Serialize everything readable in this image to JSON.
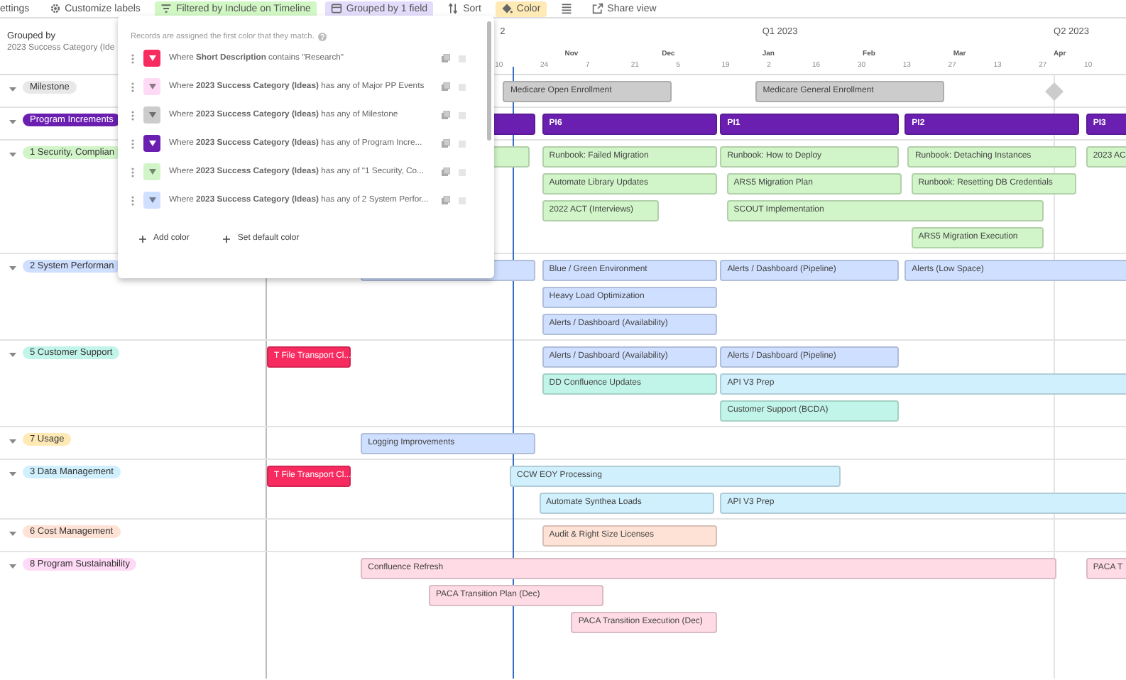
{
  "toolbar": [
    {
      "kind": "settings",
      "label": "ettings",
      "active": false
    },
    {
      "kind": "labels",
      "label": "Customize labels",
      "active": false
    },
    {
      "kind": "filter",
      "label": "Filtered by Include on Timeline",
      "active": true
    },
    {
      "kind": "group",
      "label": "Grouped by 1 field",
      "active": true
    },
    {
      "kind": "sort",
      "label": "Sort",
      "active": false
    },
    {
      "kind": "color",
      "label": "Color",
      "active": true
    },
    {
      "kind": "rowheight",
      "active": false
    },
    {
      "kind": "share",
      "label": "Share view",
      "active": false
    }
  ],
  "grouping": {
    "title": "Grouped by",
    "field": "2023 Success Category (Ide"
  },
  "axis": {
    "quarters": [
      "2",
      "Q1 2023",
      "Q2 2023"
    ],
    "months": [
      "Nov",
      "Dec",
      "Jan",
      "Feb",
      "Mar",
      "Apr"
    ],
    "weeks": [
      "10",
      "24",
      "7",
      "21",
      "5",
      "19",
      "2",
      "16",
      "30",
      "13",
      "27",
      "13",
      "27",
      "10"
    ]
  },
  "groups": [
    {
      "label": "Milestone",
      "color": "#e8e8e8",
      "expanded": true,
      "lanes": [
        [
          {
            "kind": "bar",
            "label": "Medicare Open Enrollment",
            "color": "#cccccc"
          },
          {
            "kind": "bar",
            "label": "Medicare General Enrollment",
            "color": "#cccccc"
          },
          {
            "kind": "milestone",
            "color": "#cccccc"
          }
        ]
      ]
    },
    {
      "label": "Program Increments",
      "color": "#6b1fb1",
      "expanded": true,
      "lanes": [
        [
          {
            "kind": "bar",
            "color": "#6b1fb1"
          },
          {
            "kind": "bar",
            "label": "PI6",
            "color": "#6b1fb1"
          },
          {
            "kind": "bar",
            "label": "PI1",
            "color": "#6b1fb1"
          },
          {
            "kind": "bar",
            "label": "PI2",
            "color": "#6b1fb1"
          },
          {
            "kind": "bar",
            "label": "PI3",
            "color": "#6b1fb1"
          }
        ]
      ]
    },
    {
      "label": "1 Security, Complian",
      "color": "#d1f5c8",
      "expanded": true,
      "lanes": [
        [
          {
            "kind": "bar",
            "color": "#d1f5c8"
          },
          {
            "kind": "bar",
            "label": "Runbook: Failed Migration",
            "color": "#d1f5c8"
          },
          {
            "kind": "bar",
            "label": "Runbook: How to Deploy",
            "color": "#d1f5c8"
          },
          {
            "kind": "bar",
            "label": "Runbook: Detaching Instances",
            "color": "#d1f5c8"
          },
          {
            "kind": "bar",
            "label": "2023 AC",
            "color": "#d1f5c8"
          }
        ],
        [
          {
            "kind": "bar",
            "label": "Automate Library Updates",
            "color": "#d1f5c8"
          },
          {
            "kind": "bar",
            "label": "ARS5 Migration Plan",
            "color": "#d1f5c8"
          },
          {
            "kind": "bar",
            "label": "Runbook: Resetting DB Credentials",
            "color": "#d1f5c8"
          }
        ],
        [
          {
            "kind": "bar",
            "label": "2022 ACT (Interviews)",
            "color": "#d1f5c8"
          },
          {
            "kind": "bar",
            "label": "SCOUT Implementation",
            "color": "#d1f5c8"
          }
        ],
        [
          {
            "kind": "bar",
            "label": "ARS5 Migration Execution",
            "color": "#d1f5c8"
          }
        ]
      ]
    },
    {
      "label": "2 System Performan",
      "color": "#cfdfff",
      "expanded": true,
      "lanes": [
        [
          {
            "kind": "bar",
            "color": "#cfdfff"
          },
          {
            "kind": "bar",
            "label": "Blue / Green Environment",
            "color": "#cfdfff"
          },
          {
            "kind": "bar",
            "label": "Alerts / Dashboard (Pipeline)",
            "color": "#cfdfff"
          },
          {
            "kind": "bar",
            "label": "Alerts (Low Space)",
            "color": "#cfdfff"
          }
        ],
        [
          {
            "kind": "bar",
            "label": "Heavy Load Optimization",
            "color": "#cfdfff"
          }
        ],
        [
          {
            "kind": "bar",
            "label": "Alerts / Dashboard (Availability)",
            "color": "#cfdfff"
          }
        ]
      ]
    },
    {
      "label": "5 Customer Support",
      "color": "#c2f5e9",
      "expanded": true,
      "lanes": [
        [
          {
            "kind": "bar",
            "label": "T File Transport Cl...",
            "color": "#f82b60"
          },
          {
            "kind": "bar",
            "label": "Alerts / Dashboard (Availability)",
            "color": "#cfdfff"
          },
          {
            "kind": "bar",
            "label": "Alerts / Dashboard (Pipeline)",
            "color": "#cfdfff"
          }
        ],
        [
          {
            "kind": "bar",
            "label": "DD Confluence Updates",
            "color": "#c2f5e9"
          },
          {
            "kind": "bar",
            "label": "API V3 Prep",
            "color": "#d0f0fd"
          }
        ],
        [
          {
            "kind": "bar",
            "label": "Customer Support (BCDA)",
            "color": "#c2f5e9"
          }
        ]
      ]
    },
    {
      "label": "7 Usage",
      "color": "#ffeab6",
      "expanded": true,
      "lanes": [
        [
          {
            "kind": "bar",
            "label": "Logging Improvements",
            "color": "#cfdfff"
          }
        ]
      ]
    },
    {
      "label": "3 Data Management",
      "color": "#d0f0fd",
      "expanded": true,
      "lanes": [
        [
          {
            "kind": "bar",
            "label": "T File Transport Cl...",
            "color": "#f82b60"
          },
          {
            "kind": "bar",
            "label": "CCW EOY Processing",
            "color": "#d0f0fd"
          }
        ],
        [
          {
            "kind": "bar",
            "label": "Automate Synthea Loads",
            "color": "#d0f0fd"
          },
          {
            "kind": "bar",
            "label": "API V3 Prep",
            "color": "#d0f0fd"
          }
        ]
      ]
    },
    {
      "label": "6 Cost Management",
      "color": "#fee2d5",
      "expanded": true,
      "lanes": [
        [
          {
            "kind": "bar",
            "label": "Audit & Right Size Licenses",
            "color": "#fee2d5"
          }
        ]
      ]
    },
    {
      "label": "8 Program Sustainability",
      "color": "#ffdaf6",
      "expanded": true,
      "lanes": [
        [
          {
            "kind": "bar",
            "label": "Confluence Refresh",
            "color": "#ffdce5"
          },
          {
            "kind": "bar",
            "label": "PACA T",
            "color": "#ffdce5"
          }
        ],
        [
          {
            "kind": "bar",
            "label": "PACA Transition Plan (Dec)",
            "color": "#ffdce5"
          }
        ],
        [
          {
            "kind": "bar",
            "label": "PACA Transition Execution (Dec)",
            "color": "#ffdce5"
          }
        ]
      ]
    }
  ],
  "color_popup": {
    "note": "Records are assigned the first color that they match.",
    "rules": [
      {
        "text": "Where **Short Description** contains \"Research\"",
        "color": "#f82b60"
      },
      {
        "text": "Where **2023 Success Category (Ideas)** has any of Major PP Events",
        "color": "#ffdaf6"
      },
      {
        "text": "Where **2023 Success Category (Ideas)** has any of Milestone",
        "color": "#cccccc"
      },
      {
        "text": "Where **2023 Success Category (Ideas)** has any of Program Incre...",
        "color": "#6b1fb1"
      },
      {
        "text": "Where **2023 Success Category (Ideas)** has any of \"1 Security, Co...",
        "color": "#d1f5c8"
      },
      {
        "text": "Where **2023 Success Category (Ideas)** has any of 2 System Perfor...",
        "color": "#cfdfff"
      }
    ],
    "actions": [
      "Add color",
      "Set default color"
    ]
  }
}
